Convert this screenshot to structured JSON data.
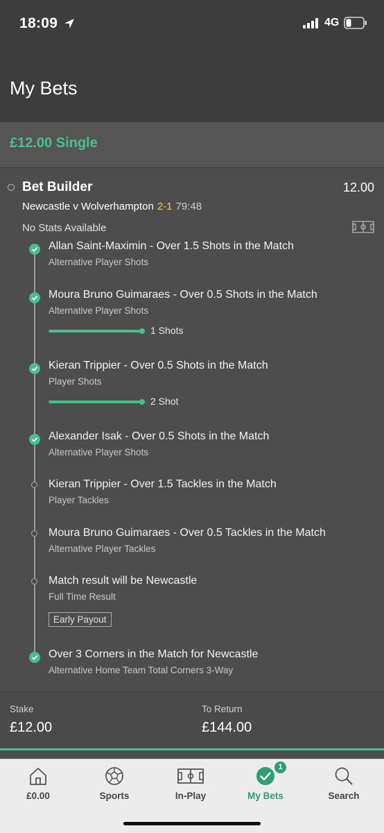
{
  "status_bar": {
    "time": "18:09",
    "network": "4G"
  },
  "header": {
    "title": "My Bets"
  },
  "bet": {
    "header_title": "£12.00 Single",
    "builder_title": "Bet Builder",
    "odds": "12.00",
    "match": {
      "teams": "Newcastle v Wolverhampton",
      "score": "2-1",
      "clock": "79:48"
    },
    "stats_text": "No Stats Available",
    "legs": [
      {
        "title": "Allan Saint-Maximin - Over 1.5 Shots in the Match",
        "subtitle": "Alternative Player Shots",
        "status": "won"
      },
      {
        "title": "Moura Bruno Guimaraes - Over 0.5 Shots in the Match",
        "subtitle": "Alternative Player Shots",
        "status": "won",
        "progress_label": "1 Shots",
        "progress": 1.0
      },
      {
        "title": "Kieran Trippier - Over 0.5 Shots in the Match",
        "subtitle": "Player Shots",
        "status": "won",
        "progress_label": "2 Shot",
        "progress": 1.0
      },
      {
        "title": "Alexander Isak - Over 0.5 Shots in the Match",
        "subtitle": "Alternative Player Shots",
        "status": "won"
      },
      {
        "title": "Kieran Trippier - Over 1.5 Tackles in the Match",
        "subtitle": "Player Tackles",
        "status": "open"
      },
      {
        "title": "Moura Bruno Guimaraes - Over 0.5 Tackles in the Match",
        "subtitle": "Alternative Player Tackles",
        "status": "open"
      },
      {
        "title": "Match result will be Newcastle",
        "subtitle": "Full Time Result",
        "status": "open",
        "tag": "Early Payout"
      },
      {
        "title": "Over 3 Corners in the Match for Newcastle",
        "subtitle": "Alternative Home Team Total Corners 3-Way",
        "status": "won"
      }
    ],
    "stake_label": "Stake",
    "stake_value": "£12.00",
    "return_label": "To Return",
    "return_value": "£144.00"
  },
  "nav": {
    "items": [
      {
        "label": "£0.00",
        "icon": "home-icon"
      },
      {
        "label": "Sports",
        "icon": "football-icon"
      },
      {
        "label": "In-Play",
        "icon": "pitch-icon"
      },
      {
        "label": "My Bets",
        "icon": "check-circle-icon",
        "badge": "1",
        "active": true
      },
      {
        "label": "Search",
        "icon": "search-icon"
      }
    ]
  },
  "colors": {
    "accent": "#46c08f",
    "score": "#f7c948",
    "background": "#4d4d4d",
    "header": "#3d3d3d"
  }
}
